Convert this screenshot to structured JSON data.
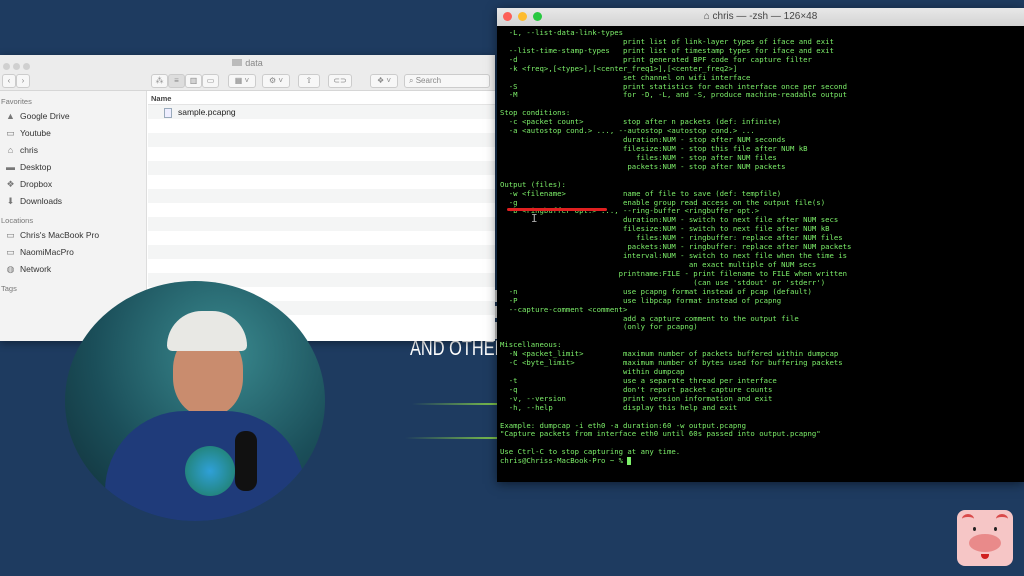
{
  "slide": {
    "text": "AND OTHER"
  },
  "finder": {
    "title": "data",
    "search_placeholder": "Search",
    "column_name": "Name",
    "files": [
      "sample.pcapng"
    ],
    "favorites_header": "Favorites",
    "favorites": [
      {
        "label": "Google Drive",
        "icon": "google-drive-icon"
      },
      {
        "label": "Youtube",
        "icon": "folder-icon"
      },
      {
        "label": "chris",
        "icon": "home-icon"
      },
      {
        "label": "Desktop",
        "icon": "desktop-icon"
      },
      {
        "label": "Dropbox",
        "icon": "dropbox-icon"
      },
      {
        "label": "Downloads",
        "icon": "downloads-icon"
      }
    ],
    "locations_header": "Locations",
    "locations": [
      {
        "label": "Chris's MacBook Pro",
        "icon": "laptop-icon"
      },
      {
        "label": "NaomiMacPro",
        "icon": "computer-icon"
      },
      {
        "label": "Network",
        "icon": "network-icon"
      }
    ],
    "tags_header": "Tags"
  },
  "terminal": {
    "title": "chris — -zsh — 126×48",
    "lines": [
      "  -L, --list-data-link-types",
      "                            print list of link-layer types of iface and exit",
      "  --list-time-stamp-types   print list of timestamp types for iface and exit",
      "  -d                        print generated BPF code for capture filter",
      "  -k <freq>,[<type>],[<center_freq1>],[<center_freq2>]",
      "                            set channel on wifi interface",
      "  -S                        print statistics for each interface once per second",
      "  -M                        for -D, -L, and -S, produce machine-readable output",
      "",
      "Stop conditions:",
      "  -c <packet count>         stop after n packets (def: infinite)",
      "  -a <autostop cond.> ..., --autostop <autostop cond.> ...",
      "                            duration:NUM - stop after NUM seconds",
      "                            filesize:NUM - stop this file after NUM kB",
      "                               files:NUM - stop after NUM files",
      "                             packets:NUM - stop after NUM packets",
      "",
      "Output (files):",
      "  -w <filename>             name of file to save (def: tempfile)",
      "  -g                        enable group read access on the output file(s)",
      "  -b <ringbuffer opt.> ..., --ring-buffer <ringbuffer opt.>",
      "                            duration:NUM - switch to next file after NUM secs",
      "                            filesize:NUM - switch to next file after NUM kB",
      "                               files:NUM - ringbuffer: replace after NUM files",
      "                             packets:NUM - ringbuffer: replace after NUM packets",
      "                            interval:NUM - switch to next file when the time is",
      "                                           an exact multiple of NUM secs",
      "                           printname:FILE - print filename to FILE when written",
      "                                            (can use 'stdout' or 'stderr')",
      "  -n                        use pcapng format instead of pcap (default)",
      "  -P                        use libpcap format instead of pcapng",
      "  --capture-comment <comment>",
      "                            add a capture comment to the output file",
      "                            (only for pcapng)",
      "",
      "Miscellaneous:",
      "  -N <packet_limit>         maximum number of packets buffered within dumpcap",
      "  -C <byte_limit>           maximum number of bytes used for buffering packets",
      "                            within dumpcap",
      "  -t                        use a separate thread per interface",
      "  -q                        don't report packet capture counts",
      "  -v, --version             print version information and exit",
      "  -h, --help                display this help and exit",
      "",
      "Example: dumpcap -i eth0 -a duration:60 -w output.pcapng",
      "\"Capture packets from interface eth0 until 60s passed into output.pcapng\"",
      "",
      "Use Ctrl-C to stop capturing at any time."
    ],
    "prompt": "chris@Chriss-MacBook-Pro ~ % "
  },
  "colors": {
    "terminal_text": "#7df06a",
    "background": "#1e3b60",
    "annotation": "#e02020"
  }
}
